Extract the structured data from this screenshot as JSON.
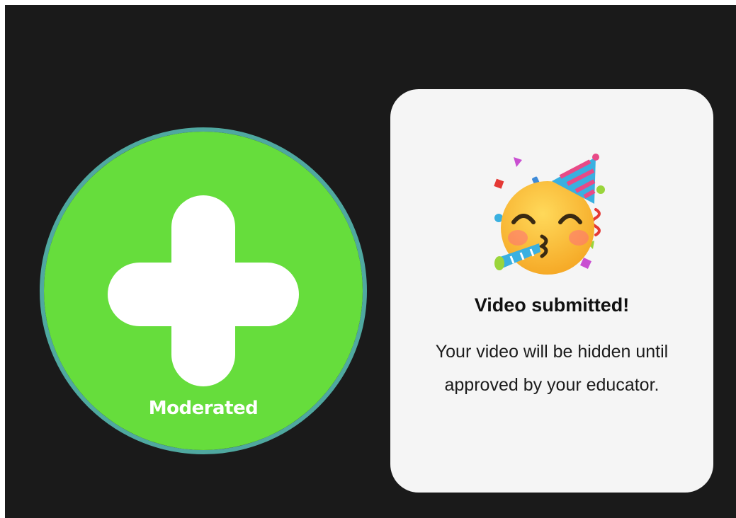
{
  "record_button": {
    "label": "Moderated",
    "fill_color": "#66dd3c",
    "ring_color": "#4fa8a0",
    "icon": "plus-icon"
  },
  "submit_card": {
    "icon": "party-face-icon",
    "title": "Video submitted!",
    "message": "Your video will be hidden until approved by your educator."
  },
  "colors": {
    "background": "#1a1a1a",
    "card_background": "#f5f5f5"
  }
}
